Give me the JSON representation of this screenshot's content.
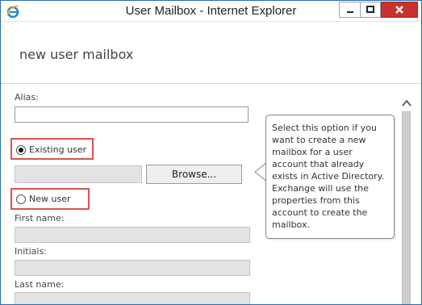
{
  "window": {
    "title": "User Mailbox - Internet Explorer"
  },
  "page": {
    "heading": "new user mailbox"
  },
  "form": {
    "alias_label": "Alias:",
    "alias_value": "",
    "existing_user_label": "Existing user",
    "existing_user_selected": true,
    "existing_user_value": "",
    "browse_label": "Browse...",
    "new_user_label": "New user",
    "new_user_selected": false,
    "first_name_label": "First name:",
    "initials_label": "Initials:",
    "last_name_label": "Last name:"
  },
  "tooltip": {
    "text": "Select this option if you want to create a new mailbox for a user account that already exists in Active Directory. Exchange will use the properties from this account to create the mailbox."
  },
  "icons": {
    "browser": "internet-explorer-icon",
    "minimize": "minimize-icon",
    "maximize": "maximize-icon",
    "close": "close-icon",
    "scroll_up": "chevron-up-icon"
  },
  "colors": {
    "window_border": "#2b6cb0",
    "close_button": "#c7332c",
    "highlight_box": "#d9534f",
    "disabled_field": "#e3e3e3"
  }
}
